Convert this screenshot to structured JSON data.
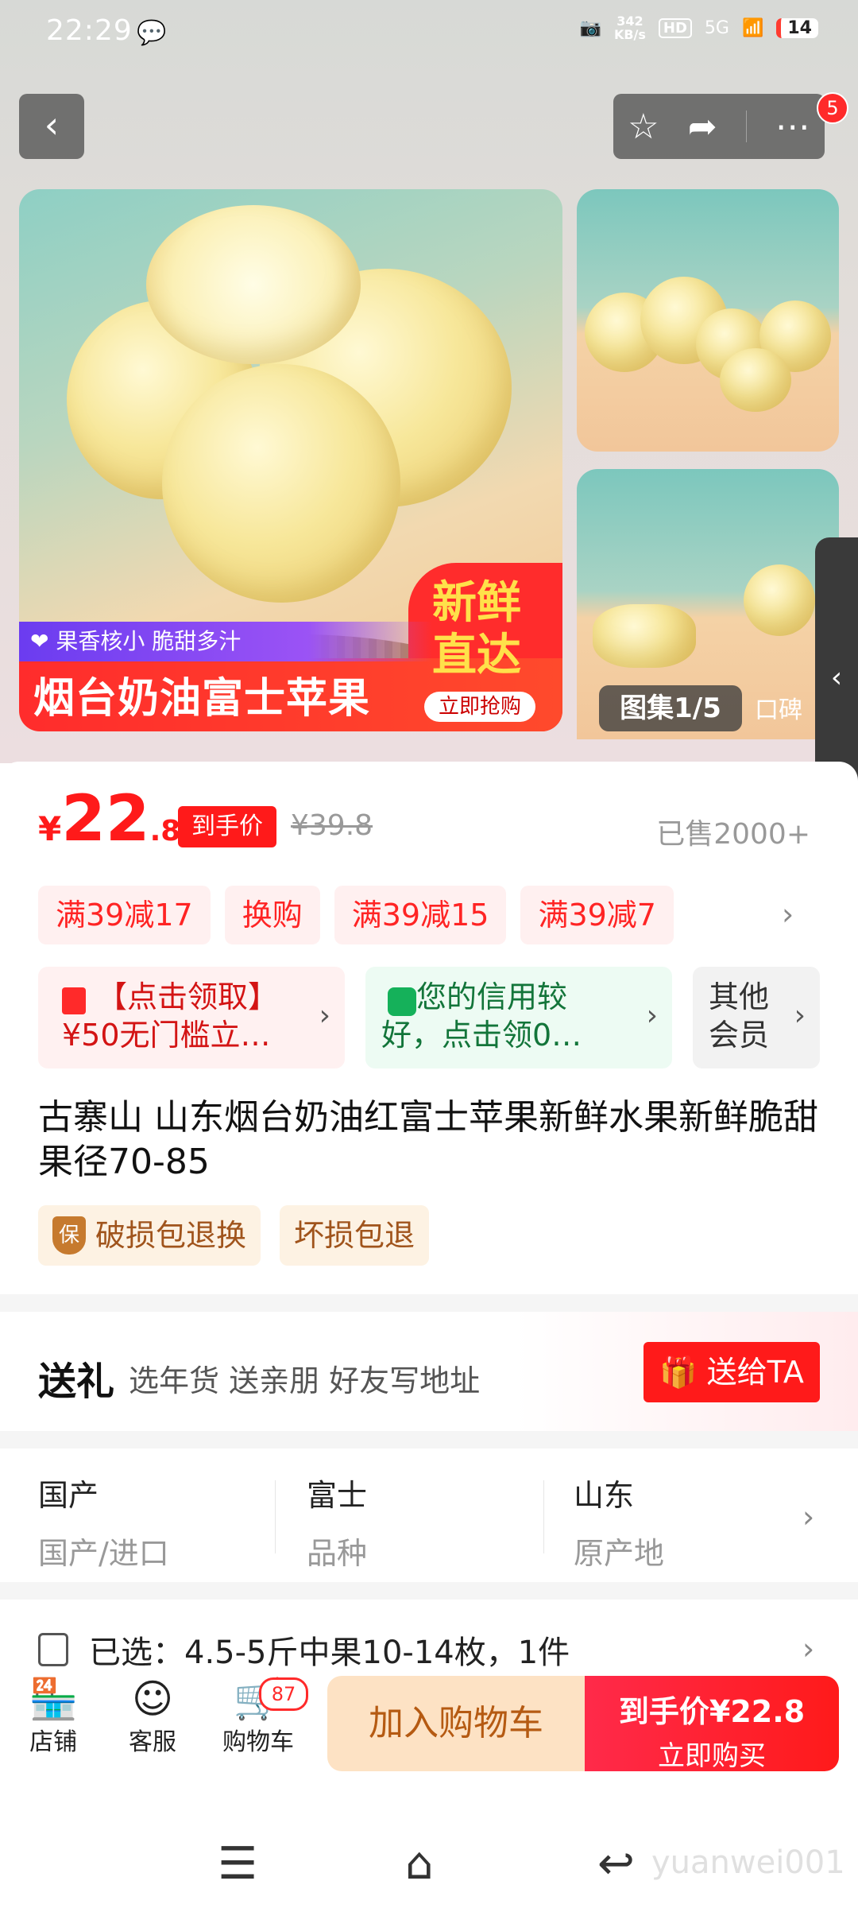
{
  "status_bar": {
    "time": "22:29",
    "network_speed": "342\nKB/s",
    "hd": "HD",
    "signal": "5G",
    "battery": "14"
  },
  "nav": {
    "back_icon": "chevron-left-icon",
    "message_badge": "5"
  },
  "gallery": {
    "feature_tag": "❤ 果香核小  脆甜多汁",
    "banner_title": "烟台奶油富士苹果",
    "fresh_line1": "新鲜",
    "fresh_line2": "直达",
    "buy_now": "立即抢购",
    "gallery_counter": "图集1/5",
    "review_tab": "口碑"
  },
  "price": {
    "currency": "¥",
    "integer": "22",
    "decimal": ".8",
    "price_tag": "到手价",
    "original_price": "¥39.8",
    "sold": "已售2000+"
  },
  "coupons": [
    "满39减17",
    "换购",
    "满39减15",
    "满39减7"
  ],
  "promo_cards": {
    "red_line1": "【点击领取】",
    "red_line2": "¥50无门槛立…",
    "green_line1": "您的信用较",
    "green_line2": "好，点击领0…",
    "gray_line1": "其他",
    "gray_line2": "会员"
  },
  "product": {
    "title": "古寨山 山东烟台奶油红富士苹果新鲜水果新鲜脆甜果径70-85",
    "guarantee1_icon": "保",
    "guarantee1": "破损包退换",
    "guarantee2": "坏损包退"
  },
  "gift": {
    "title": "送礼",
    "subtitle": "选年货 送亲朋 好友写地址",
    "button": "送给TA"
  },
  "specs": [
    {
      "value": "国产",
      "key": "国产/进口"
    },
    {
      "value": "富士",
      "key": "品种"
    },
    {
      "value": "山东",
      "key": "原产地"
    }
  ],
  "selected": {
    "text": "已选：4.5-5斤中果10-14枚，1件"
  },
  "bottom_bar": {
    "shop": "店铺",
    "service": "客服",
    "cart": "购物车",
    "cart_count": "87",
    "add_to_cart": "加入购物车",
    "buy_line1": "到手价¥22.8",
    "buy_line2": "立即购买"
  },
  "watermark": "yuanwei001"
}
